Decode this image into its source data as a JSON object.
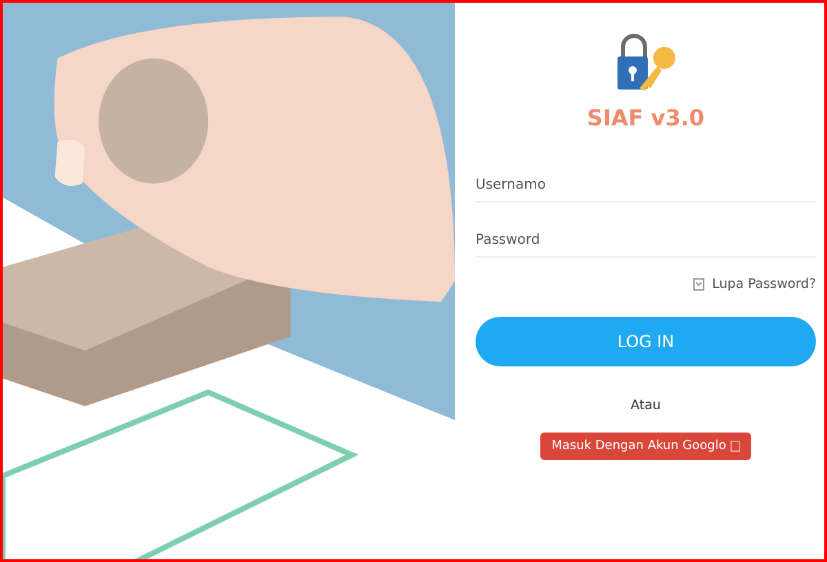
{
  "app": {
    "title": "SIAF v3.0"
  },
  "fields": [
    {
      "placeholder": "Usernamo"
    },
    {
      "placeholder": "Password"
    }
  ],
  "forgot_link": {
    "label": "Lupa Password?"
  },
  "login_button": {
    "label": "LOG IN"
  },
  "separator": "Atau",
  "google_button": {
    "label": "Masuk Dengan Akun Googlo"
  }
}
